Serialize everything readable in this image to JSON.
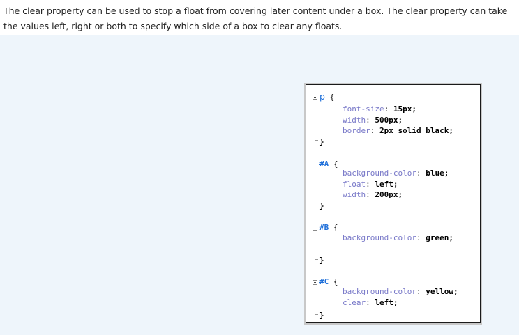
{
  "intro": {
    "text": "The clear property can be used to stop a float from covering later content under a box. The clear property can take the values left, right or both to specify which side of a box to clear any floats."
  },
  "code": {
    "rules": [
      {
        "selector": "p",
        "open": "{",
        "close": "}",
        "declarations": [
          {
            "property": "font-size",
            "value": "15px;"
          },
          {
            "property": "width",
            "value": "500px;"
          },
          {
            "property": "border",
            "value": "2px solid black;"
          }
        ]
      },
      {
        "selector": "#A",
        "open": "{",
        "close": "}",
        "declarations": [
          {
            "property": "background-color",
            "value": "blue;"
          },
          {
            "property": "float",
            "value": "left;"
          },
          {
            "property": "width",
            "value": "200px;"
          }
        ]
      },
      {
        "selector": "#B",
        "open": "{",
        "close": "}",
        "declarations": [
          {
            "property": "background-color",
            "value": "green;"
          }
        ]
      },
      {
        "selector": "#C",
        "open": "{",
        "close": "}",
        "declarations": [
          {
            "property": "background-color",
            "value": "yellow;"
          },
          {
            "property": "clear",
            "value": "left;"
          }
        ]
      }
    ]
  },
  "colors": {
    "selector": "#1e6fd9",
    "property": "#7878c8",
    "page_background": "#eef5fb"
  }
}
